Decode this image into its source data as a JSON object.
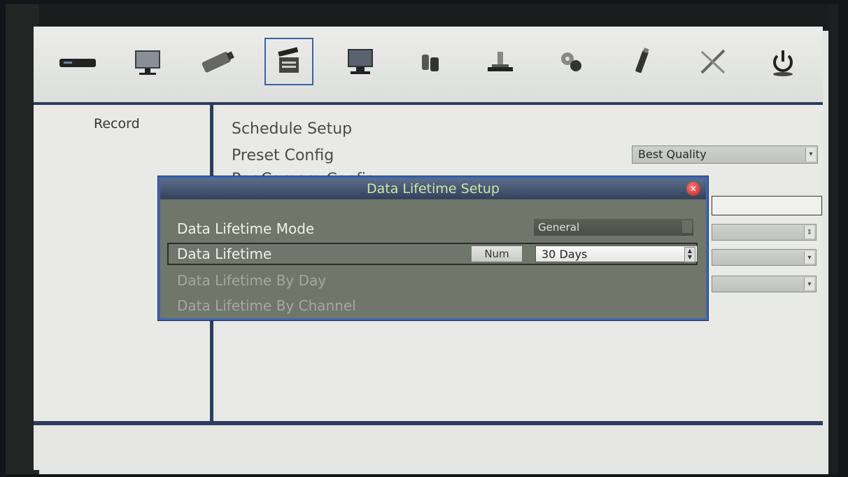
{
  "toolbar": {
    "items": [
      {
        "icon": "dvr-icon",
        "selected": false
      },
      {
        "icon": "monitor-icon",
        "selected": false
      },
      {
        "icon": "camera-icon",
        "selected": false
      },
      {
        "icon": "clapperboard-icon",
        "selected": true
      },
      {
        "icon": "display-icon",
        "selected": false
      },
      {
        "icon": "network-icon",
        "selected": false
      },
      {
        "icon": "storage-icon",
        "selected": false
      },
      {
        "icon": "gears-icon",
        "selected": false
      },
      {
        "icon": "usb-icon",
        "selected": false
      },
      {
        "icon": "tools-icon",
        "selected": false
      },
      {
        "icon": "power-icon",
        "selected": false
      }
    ]
  },
  "left": {
    "title": "Record"
  },
  "right": {
    "items": [
      "Schedule Setup",
      "Preset Config",
      "Per Camera Config"
    ],
    "preset_value": "Best Quality"
  },
  "dialog": {
    "title": "Data Lifetime Setup",
    "close": "✕",
    "mode_label": "Data Lifetime Mode",
    "mode_value": "General",
    "lifetime_label": "Data Lifetime",
    "num_label": "Num",
    "lifetime_value": "30 Days",
    "by_day_label": "Data Lifetime By Day",
    "by_channel_label": "Data Lifetime By Channel"
  },
  "colors": {
    "frame": "#2c3c5c",
    "dialog_border": "#3d66b4",
    "dialog_bg": "#71766a",
    "title_text": "#cfe7a8"
  }
}
